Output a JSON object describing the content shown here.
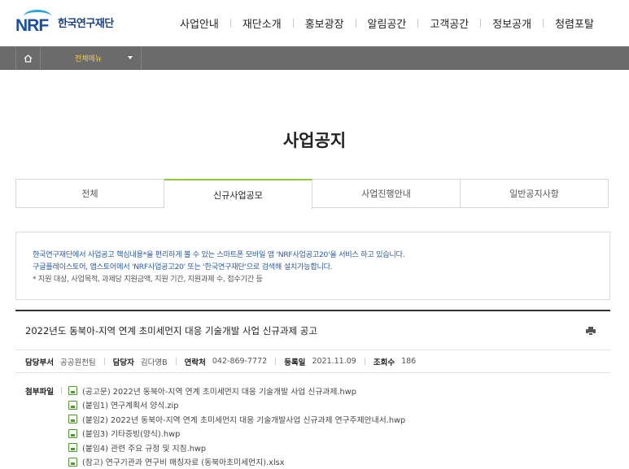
{
  "header": {
    "logo_mark": "NRF",
    "logo_text": "한국연구재단",
    "nav": [
      "사업안내",
      "재단소개",
      "홍보광장",
      "알림공간",
      "고객공간",
      "정보공개",
      "청렴포탈"
    ]
  },
  "subbar": {
    "home_icon": "home-icon",
    "menu_label": "전체메뉴"
  },
  "page_title": "사업공지",
  "tabs": [
    {
      "label": "전체",
      "active": false
    },
    {
      "label": "신규사업공모",
      "active": true
    },
    {
      "label": "사업진행안내",
      "active": false
    },
    {
      "label": "일반공지사항",
      "active": false
    }
  ],
  "notice": {
    "line1": "한국연구재단에서 사업공고 핵심내용*을 편리하게 볼 수 있는 스마트폰 모바일 앱 'NRF사업공고20'을 서비스 하고 있습니다.",
    "line2": "구글플레이스토어, 앱스토어에서 'NRF사업공고20' 또는 '한국연구재단'으로 검색해 설치가능합니다.",
    "line3": "* 지원 대상, 사업목적, 과제당 지원금액, 지원 기간, 지원과제 수, 접수기간 등"
  },
  "article": {
    "title": "2022년도 동북아-지역 연계 초미세먼지 대응 기술개발 사업 신규과제 공고",
    "meta": {
      "dept_label": "담당부서",
      "dept": "공공원천팀",
      "person_label": "담당자",
      "person": "김다영B",
      "phone_label": "연락처",
      "phone": "042-869-7772",
      "date_label": "등록일",
      "date": "2021.11.09",
      "views_label": "조회수",
      "views": "186"
    },
    "files_label": "첨부파일",
    "files": [
      "(공고문) 2022년 동북아-지역 연계 초미세먼지 대응 기술개발 사업 신규과제.hwp",
      "(붙임1) 연구계획서 양식.zip",
      "(붙임2) 2022년 동북아-지역 연계 초미세먼지 대응 기술개발사업 신규과제 연구주제안내서.hwp",
      "(붙임3) 기타증빙(양식).hwp",
      "(붙임4) 관련 주요 규정 및 지침.hwp",
      "(참고) 연구기관과 연구비 매칭자료 (동북아초미세먼지).xlsx"
    ]
  }
}
